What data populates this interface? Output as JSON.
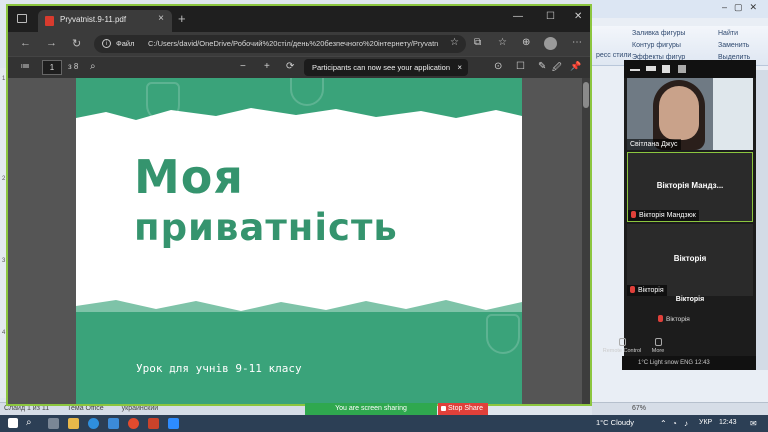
{
  "colors": {
    "slide_green": "#3aa37a",
    "title_green": "#35946e",
    "zoom_active_border": "#8cc63f",
    "share_green": "#2fa84f",
    "stop_red": "#e0403a"
  },
  "powerpoint": {
    "ribbon_items": [
      "Заливка фигуры",
      "Контур фигуры",
      "Эффекты фигур",
      "Найти",
      "Заменить",
      "Выделить",
      "ресс стили"
    ],
    "ruler_numbers": [
      "1",
      "2",
      "3",
      "4"
    ],
    "status_left": [
      "Слайд 1 из 11",
      "Тема Office",
      "украинский"
    ],
    "zoom_percent": "67%"
  },
  "edge": {
    "tab_title": "Pryvatnist.9-11.pdf",
    "tab_close": "×",
    "new_tab": "+",
    "window_controls": [
      "—",
      "☐",
      "✕"
    ],
    "nav_icons": [
      "←",
      "→",
      "↻"
    ],
    "url_label": "Файл",
    "url": "C:/Users/david/OneDrive/Робочий%20стіл/день%20безпечного%20інтернету/Pryvatni...",
    "toolbar_icons": [
      "☆",
      "⧉",
      "☆",
      "⊕",
      "⋯"
    ]
  },
  "pdf": {
    "page_current": "1",
    "page_total": "з 8",
    "toolbar_icons_left": [
      "≔",
      "⌕"
    ],
    "toolbar_icons_right": [
      "−",
      "+",
      "⟳",
      "⊙",
      "☐",
      "✎",
      "🖉",
      "📌"
    ],
    "zoom_tip": "Participants can now see your application",
    "zoom_tip_close": "×"
  },
  "slide": {
    "title_line_1": "Моя",
    "title_line_2": "приватність",
    "subtitle": "Урок для учнів 9-11 класу"
  },
  "zoom": {
    "participant_1": "Світлана Джус",
    "participant_2_big": "Вікторія Мандз...",
    "participant_2_small": "Вікторія Мандзюк",
    "participant_3_big": "Вікторія",
    "participant_3_small": "Вікторія",
    "participant_4_big": "Вікторія",
    "participant_4_small": "Вікторія",
    "remote_control": "Remote Control",
    "more": "More",
    "mini_bar": "1°C  Light snow    ENG   12:43",
    "sharing_label": "You are screen sharing",
    "stop_share": "Stop Share"
  },
  "taskbar": {
    "weather": "1°C  Cloudy",
    "language": "УКР",
    "time": "12:43",
    "tray_icons": [
      "⌃",
      "◔",
      "♪",
      "✉"
    ]
  }
}
